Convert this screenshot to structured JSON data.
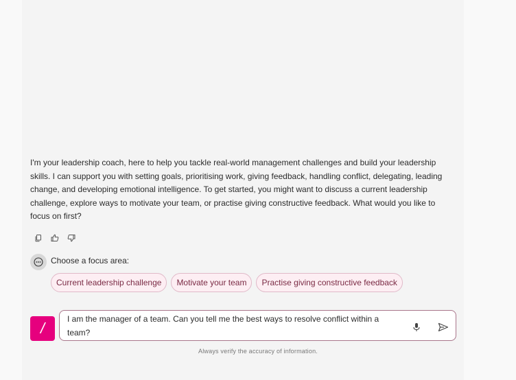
{
  "chat": {
    "assistant_message": "I'm your leadership coach, here to help you tackle real-world management challenges and build your leadership skills. I can support you with setting goals, prioritising work, giving feedback, handling conflict, delegating, leading change, and developing emotional intelligence. To get started, you might want to discuss a current leadership challenge, explore ways to motivate your team, or practise giving constructive feedback. What would you like to focus on first?"
  },
  "actions": {
    "copy_icon": "copy-icon",
    "like_icon": "thumbs-up-icon",
    "dislike_icon": "thumbs-down-icon"
  },
  "focus": {
    "label": "Choose a focus area:",
    "options": [
      "Current leadership challenge",
      "Motivate your team",
      "Practise giving constructive feedback"
    ]
  },
  "composer": {
    "logo_text": "/",
    "input_value": "I am the manager of a team. Can you tell me the best ways to resolve conflict within a team?"
  },
  "footer": {
    "disclaimer": "Always verify the accuracy of information."
  },
  "colors": {
    "brand": "#e6007e",
    "chip_bg": "#fdeef3",
    "chip_border": "#e0b9c8",
    "input_border": "#a8758a"
  }
}
